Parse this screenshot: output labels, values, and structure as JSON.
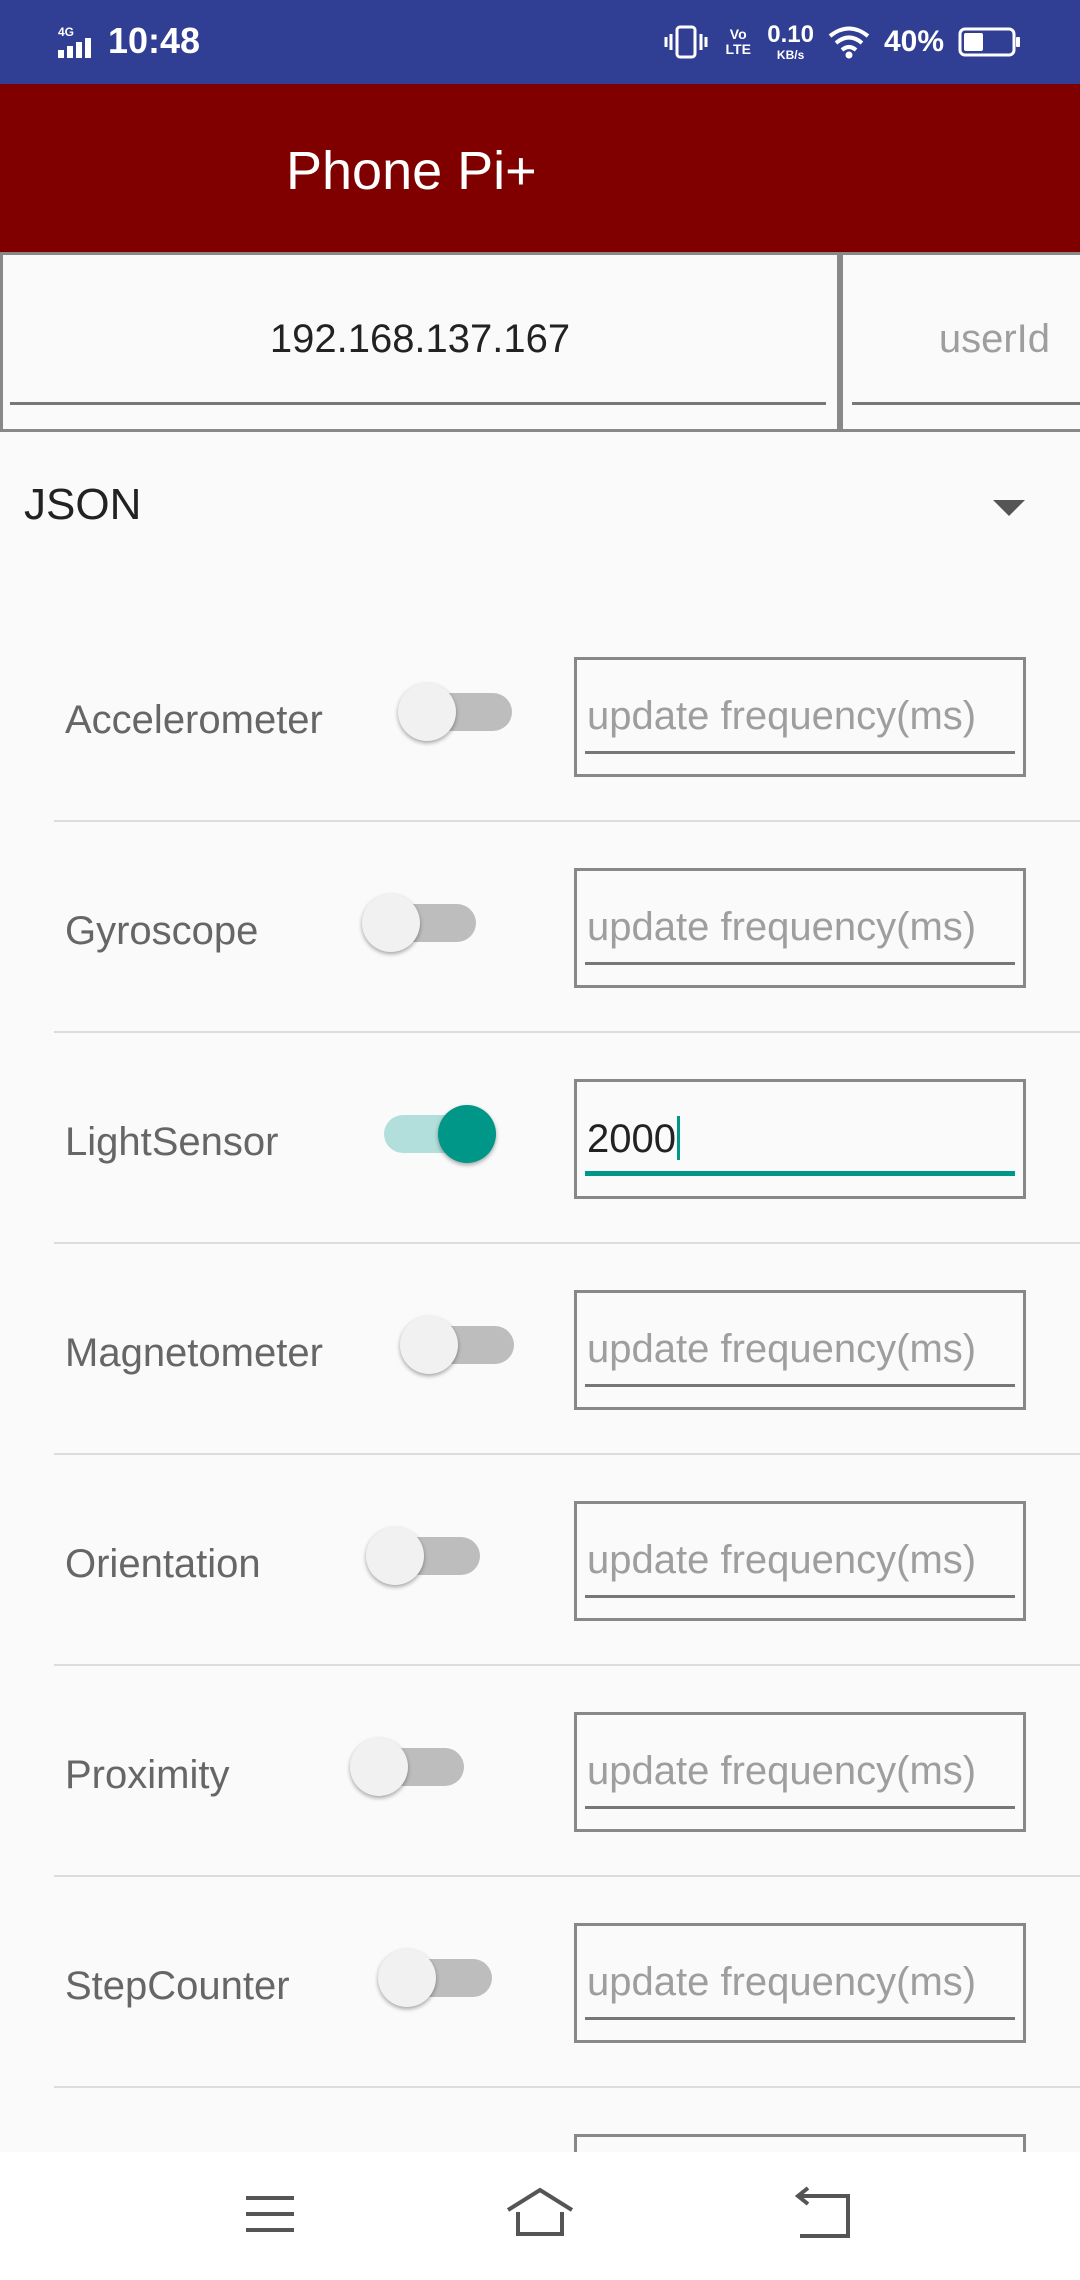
{
  "status_bar": {
    "network": "4G",
    "time": "10:48",
    "volte": "Vo LTE",
    "speed_value": "0.10",
    "speed_unit": "KB/s",
    "battery_percent": "40%"
  },
  "toolbar": {
    "title": "Phone Pi+"
  },
  "connection": {
    "ip_value": "192.168.137.167",
    "user_id_placeholder": "userId"
  },
  "format_spinner": {
    "selected": "JSON"
  },
  "sensors": [
    {
      "label": "Accelerometer",
      "enabled": false,
      "frequency_value": "",
      "frequency_placeholder": "update frequency(ms)"
    },
    {
      "label": "Gyroscope",
      "enabled": false,
      "frequency_value": "",
      "frequency_placeholder": "update frequency(ms)"
    },
    {
      "label": "LightSensor",
      "enabled": true,
      "frequency_value": "2000",
      "frequency_placeholder": "update frequency(ms)"
    },
    {
      "label": "Magnetometer",
      "enabled": false,
      "frequency_value": "",
      "frequency_placeholder": "update frequency(ms)"
    },
    {
      "label": "Orientation",
      "enabled": false,
      "frequency_value": "",
      "frequency_placeholder": "update frequency(ms)"
    },
    {
      "label": "Proximity",
      "enabled": false,
      "frequency_value": "",
      "frequency_placeholder": "update frequency(ms)"
    },
    {
      "label": "StepCounter",
      "enabled": false,
      "frequency_value": "",
      "frequency_placeholder": "update frequency(ms)"
    }
  ],
  "colors": {
    "status_bar": "#303f94",
    "toolbar": "#800000",
    "accent": "#009688"
  },
  "nav_bar": {
    "icons": [
      "menu-icon",
      "home-icon",
      "back-icon"
    ]
  }
}
